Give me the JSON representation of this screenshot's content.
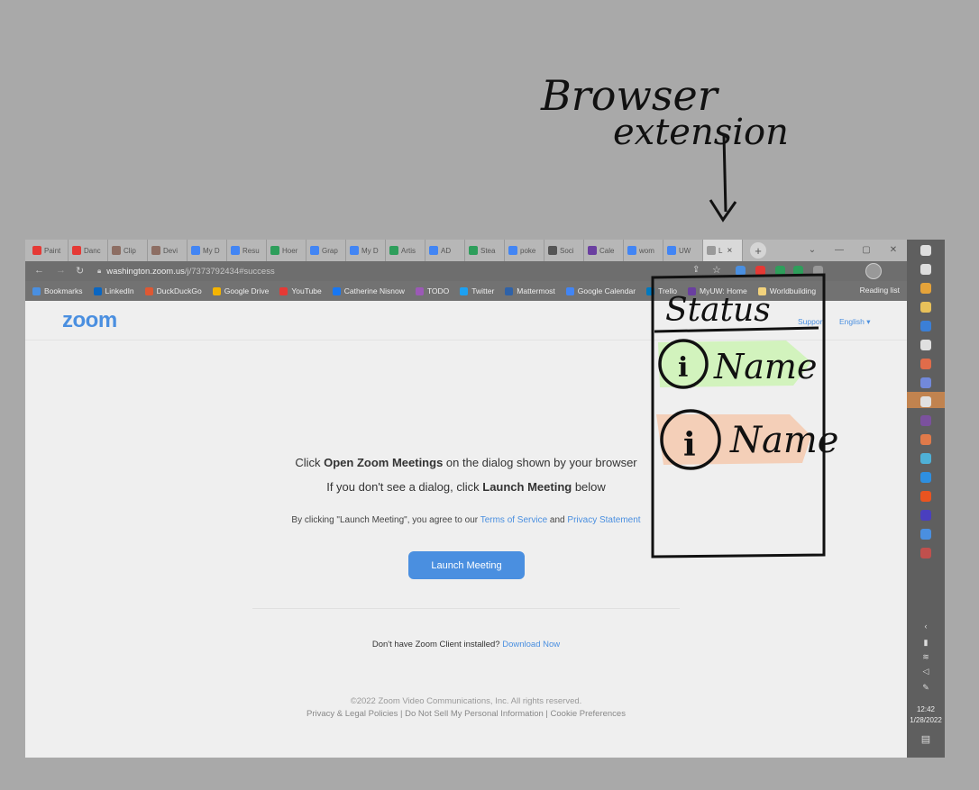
{
  "annotation": {
    "label_line1": "Browser",
    "label_line2": "extension",
    "panel_title": "Status",
    "entry1_name": "Name",
    "entry1_color": "#d2f3bd",
    "entry2_name": "Name",
    "entry2_color": "#f4cfb8"
  },
  "browser": {
    "tabs": [
      {
        "label": "Paint",
        "color": "#e53935"
      },
      {
        "label": "Danc",
        "color": "#e53935"
      },
      {
        "label": "Clip",
        "color": "#8d6e63"
      },
      {
        "label": "Devi",
        "color": "#8d6e63"
      },
      {
        "label": "My D",
        "color": "#4285f4"
      },
      {
        "label": "Resu",
        "color": "#4285f4"
      },
      {
        "label": "Hoer",
        "color": "#2e9e5b"
      },
      {
        "label": "Grap",
        "color": "#4285f4"
      },
      {
        "label": "My D",
        "color": "#4285f4"
      },
      {
        "label": "Artis",
        "color": "#2e9e5b"
      },
      {
        "label": "AD",
        "color": "#4285f4"
      },
      {
        "label": "Stea",
        "color": "#2e9e5b"
      },
      {
        "label": "poke",
        "color": "#4285f4"
      },
      {
        "label": "Soci",
        "color": "#555555"
      },
      {
        "label": "Cale",
        "color": "#6a3fa0"
      },
      {
        "label": "wom",
        "color": "#4285f4"
      },
      {
        "label": "UW",
        "color": "#4285f4"
      }
    ],
    "active_tab": {
      "label": "L",
      "close": "×"
    },
    "new_tab": "+",
    "url_host": "washington.zoom.us",
    "url_path": "/j/7373792434#success",
    "bookmarks": [
      {
        "label": "Bookmarks",
        "color": "#4a8fe0"
      },
      {
        "label": "LinkedIn",
        "color": "#0a66c2"
      },
      {
        "label": "DuckDuckGo",
        "color": "#de5833"
      },
      {
        "label": "Google Drive",
        "color": "#f4b400"
      },
      {
        "label": "YouTube",
        "color": "#e53935"
      },
      {
        "label": "Catherine Nisnow",
        "color": "#1877f2"
      },
      {
        "label": "TODO",
        "color": "#9b59b6"
      },
      {
        "label": "Twitter",
        "color": "#1da1f2"
      },
      {
        "label": "Mattermost",
        "color": "#2f62a8"
      },
      {
        "label": "Google Calendar",
        "color": "#4285f4"
      },
      {
        "label": "Trello",
        "color": "#0079bf"
      },
      {
        "label": "MyUW: Home",
        "color": "#6a3fa0"
      },
      {
        "label": "Worldbuilding",
        "color": "#f2d27c"
      }
    ],
    "reading_list": "Reading list"
  },
  "zoom": {
    "logo": "zoom",
    "support": "Support",
    "language": "English ▾",
    "line1_pre": "Click ",
    "line1_bold": "Open Zoom Meetings",
    "line1_post": " on the dialog shown by your browser",
    "line2_pre": "If you don't see a dialog, click ",
    "line2_bold": "Launch Meeting",
    "line2_post": " below",
    "agree_pre": "By clicking \"Launch Meeting\", you agree to our ",
    "terms": "Terms of Service",
    "and": " and ",
    "privacy": "Privacy Statement",
    "launch_button": "Launch Meeting",
    "no_client": "Don't have Zoom Client installed? ",
    "download": "Download Now",
    "copyright": "©2022 Zoom Video Communications, Inc. All rights reserved.",
    "legal_links": "Privacy & Legal Policies | Do Not Sell My Personal Information | Cookie Preferences"
  },
  "taskbar": {
    "time": "12:42",
    "date": "1/28/2022",
    "apps": [
      {
        "name": "windows-start-icon",
        "color": "#dddddd"
      },
      {
        "name": "search-icon",
        "color": "#dddddd"
      },
      {
        "name": "chrome-icon",
        "color": "#e5a33a"
      },
      {
        "name": "file-explorer-icon",
        "color": "#e8c15a"
      },
      {
        "name": "photoshop-icon",
        "color": "#3b7fd6"
      },
      {
        "name": "chat-icon",
        "color": "#e0e0e0"
      },
      {
        "name": "paint-icon",
        "color": "#e06c4a"
      },
      {
        "name": "discord-icon",
        "color": "#7289da"
      },
      {
        "name": "clock-app-icon",
        "color": "#e0e0e0"
      },
      {
        "name": "viber-icon",
        "color": "#7b519d"
      },
      {
        "name": "app-orange-icon",
        "color": "#e07a4a"
      },
      {
        "name": "app-blue-icon",
        "color": "#4fb0d6"
      },
      {
        "name": "vscode-icon",
        "color": "#2e8fe0"
      },
      {
        "name": "ubuntu-icon",
        "color": "#e95420"
      },
      {
        "name": "aftereffects-icon",
        "color": "#4a3fbf"
      },
      {
        "name": "zoom-app-icon",
        "color": "#4a8fe0"
      },
      {
        "name": "archive-icon",
        "color": "#c0504d"
      }
    ]
  }
}
